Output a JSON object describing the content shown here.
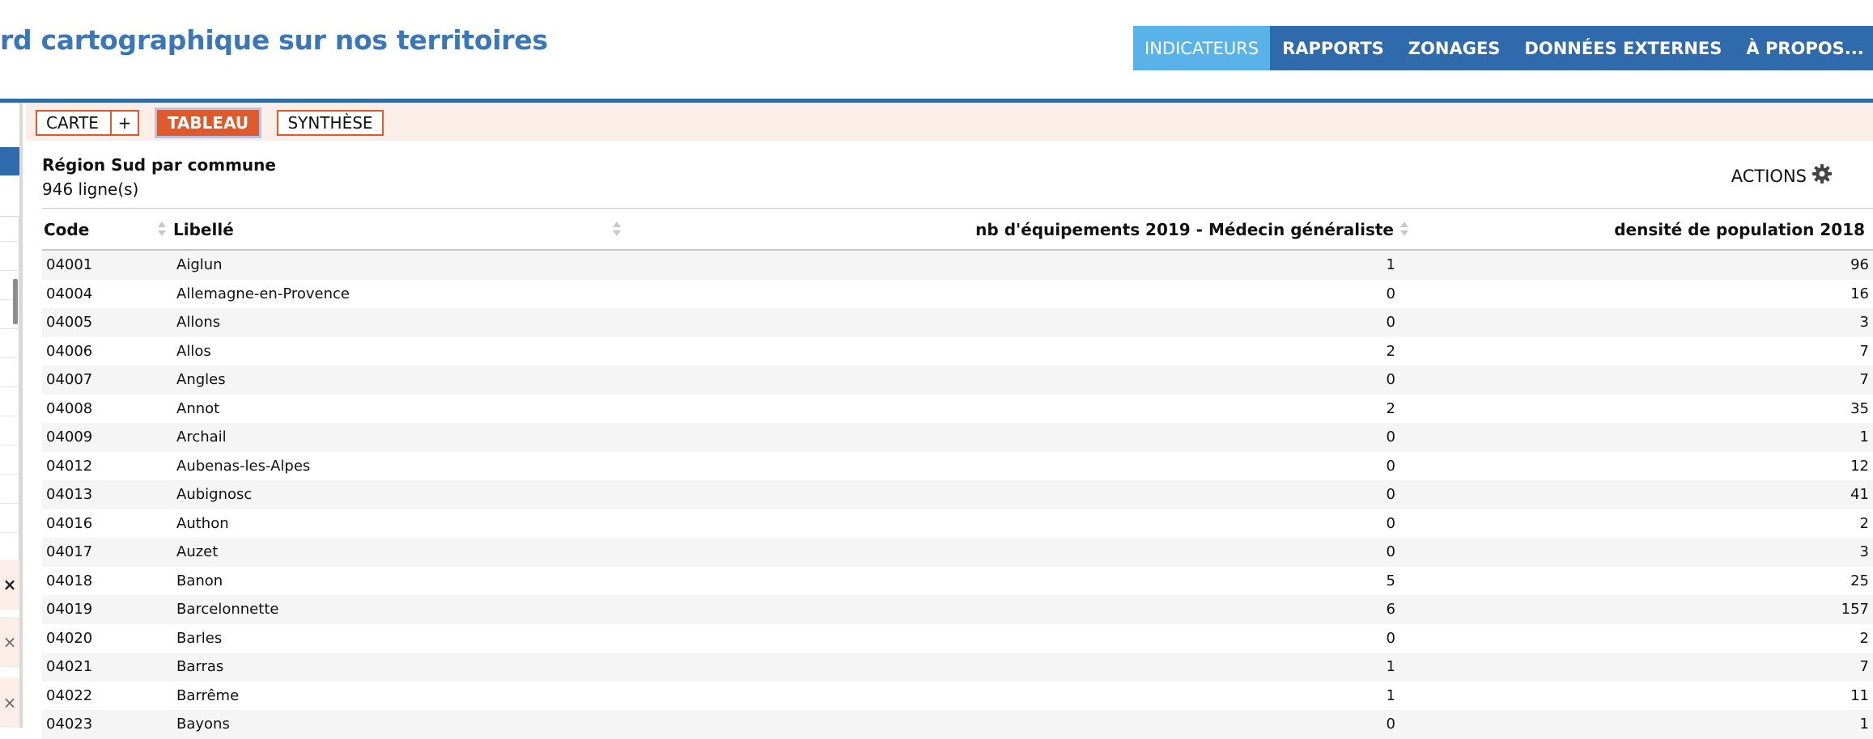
{
  "header": {
    "title": "rd cartographique sur nos territoires",
    "nav": [
      "INDICATEURS",
      "RAPPORTS",
      "ZONAGES",
      "DONNÉES EXTERNES",
      "À PROPOS..."
    ],
    "user_icon": "user-icon"
  },
  "tabs": {
    "carte": "CARTE",
    "plus": "+",
    "tableau": "TABLEAU",
    "synthese": "SYNTHÈSE"
  },
  "table": {
    "title": "Région Sud par commune",
    "count": "946 ligne(s)",
    "actions_label": "ACTIONS",
    "columns": {
      "code": "Code",
      "libelle": "Libellé",
      "nb": "nb d'équipements 2019 - Médecin généraliste",
      "densite": "densité de population 2018"
    },
    "rows": [
      {
        "code": "04001",
        "libelle": "Aiglun",
        "nb": "1",
        "densite": "96"
      },
      {
        "code": "04004",
        "libelle": "Allemagne-en-Provence",
        "nb": "0",
        "densite": "16"
      },
      {
        "code": "04005",
        "libelle": "Allons",
        "nb": "0",
        "densite": "3"
      },
      {
        "code": "04006",
        "libelle": "Allos",
        "nb": "2",
        "densite": "7"
      },
      {
        "code": "04007",
        "libelle": "Angles",
        "nb": "0",
        "densite": "7"
      },
      {
        "code": "04008",
        "libelle": "Annot",
        "nb": "2",
        "densite": "35"
      },
      {
        "code": "04009",
        "libelle": "Archail",
        "nb": "0",
        "densite": "1"
      },
      {
        "code": "04012",
        "libelle": "Aubenas-les-Alpes",
        "nb": "0",
        "densite": "12"
      },
      {
        "code": "04013",
        "libelle": "Aubignosc",
        "nb": "0",
        "densite": "41"
      },
      {
        "code": "04016",
        "libelle": "Authon",
        "nb": "0",
        "densite": "2"
      },
      {
        "code": "04017",
        "libelle": "Auzet",
        "nb": "0",
        "densite": "3"
      },
      {
        "code": "04018",
        "libelle": "Banon",
        "nb": "5",
        "densite": "25"
      },
      {
        "code": "04019",
        "libelle": "Barcelonnette",
        "nb": "6",
        "densite": "157"
      },
      {
        "code": "04020",
        "libelle": "Barles",
        "nb": "0",
        "densite": "2"
      },
      {
        "code": "04021",
        "libelle": "Barras",
        "nb": "1",
        "densite": "7"
      },
      {
        "code": "04022",
        "libelle": "Barrême",
        "nb": "1",
        "densite": "11"
      },
      {
        "code": "04023",
        "libelle": "Bayons",
        "nb": "0",
        "densite": "1"
      }
    ]
  },
  "sidebar": {
    "close_marks": [
      "×",
      "×",
      "×"
    ]
  },
  "colors": {
    "brand_blue": "#2f6aac",
    "active_nav": "#5ab3e8",
    "accent_orange": "#de5a2c",
    "tabbar_bg": "#fbede8"
  }
}
